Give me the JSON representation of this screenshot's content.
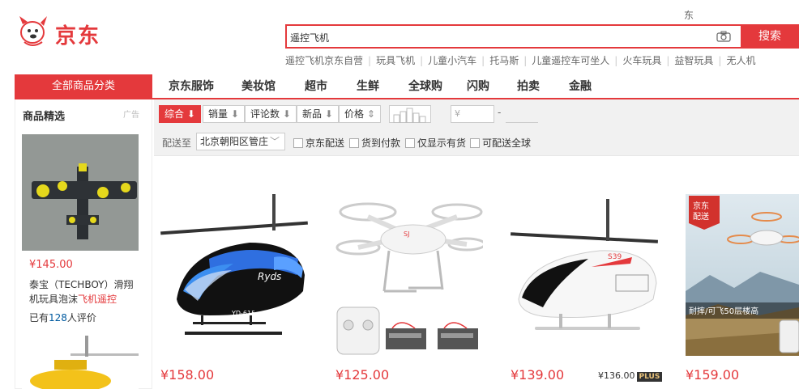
{
  "header": {
    "logo_text": "京东",
    "top_link": "东"
  },
  "search": {
    "value": "遥控飞机",
    "button_label": "搜索",
    "hot_words": [
      "遥控飞机京东自营",
      "玩具飞机",
      "儿童小汽车",
      "托马斯",
      "儿童遥控车可坐人",
      "火车玩具",
      "益智玩具",
      "无人机"
    ]
  },
  "nav": {
    "category_label": "全部商品分类",
    "items": [
      "京东服饰",
      "美妆馆",
      "超市",
      "生鲜",
      "全球购",
      "闪购",
      "拍卖",
      "金融"
    ]
  },
  "sidebar": {
    "title": "商品精选",
    "ad_label": "广告",
    "product": {
      "price": "¥145.00",
      "name_plain": "泰宝（TECHBOY）滑翔机玩具泡沫",
      "name_highlight": "飞机遥控",
      "review_prefix": "已有",
      "review_count": "128",
      "review_suffix": "人评价"
    }
  },
  "filters": {
    "sort": [
      {
        "label": "综合",
        "arrow": "⬇",
        "active": true
      },
      {
        "label": "销量",
        "arrow": "⬇",
        "active": false
      },
      {
        "label": "评论数",
        "arrow": "⬇",
        "active": false
      },
      {
        "label": "新品",
        "arrow": "⬇",
        "active": false
      },
      {
        "label": "价格",
        "arrow": "⇕",
        "active": false
      }
    ],
    "price_placeholder": "¥",
    "price_dash": "-",
    "ship_label": "配送至",
    "ship_location": "北京朝阳区管庄",
    "checkboxes": [
      "京东配送",
      "货到付款",
      "仅显示有货",
      "可配送全球"
    ]
  },
  "products": [
    {
      "price": "¥158.00",
      "image_text": "Ryds",
      "model": "YD-615"
    },
    {
      "price": "¥125.00"
    },
    {
      "price": "¥139.00",
      "plus_price": "¥136.00",
      "plus_label": "PLUS",
      "image_text": "S39"
    },
    {
      "price": "¥159.00",
      "badge": "京东配送",
      "caption": "耐摔/可飞50层楼高"
    }
  ],
  "colors": {
    "brand_red": "#e4393c",
    "link_blue": "#005aa0"
  }
}
